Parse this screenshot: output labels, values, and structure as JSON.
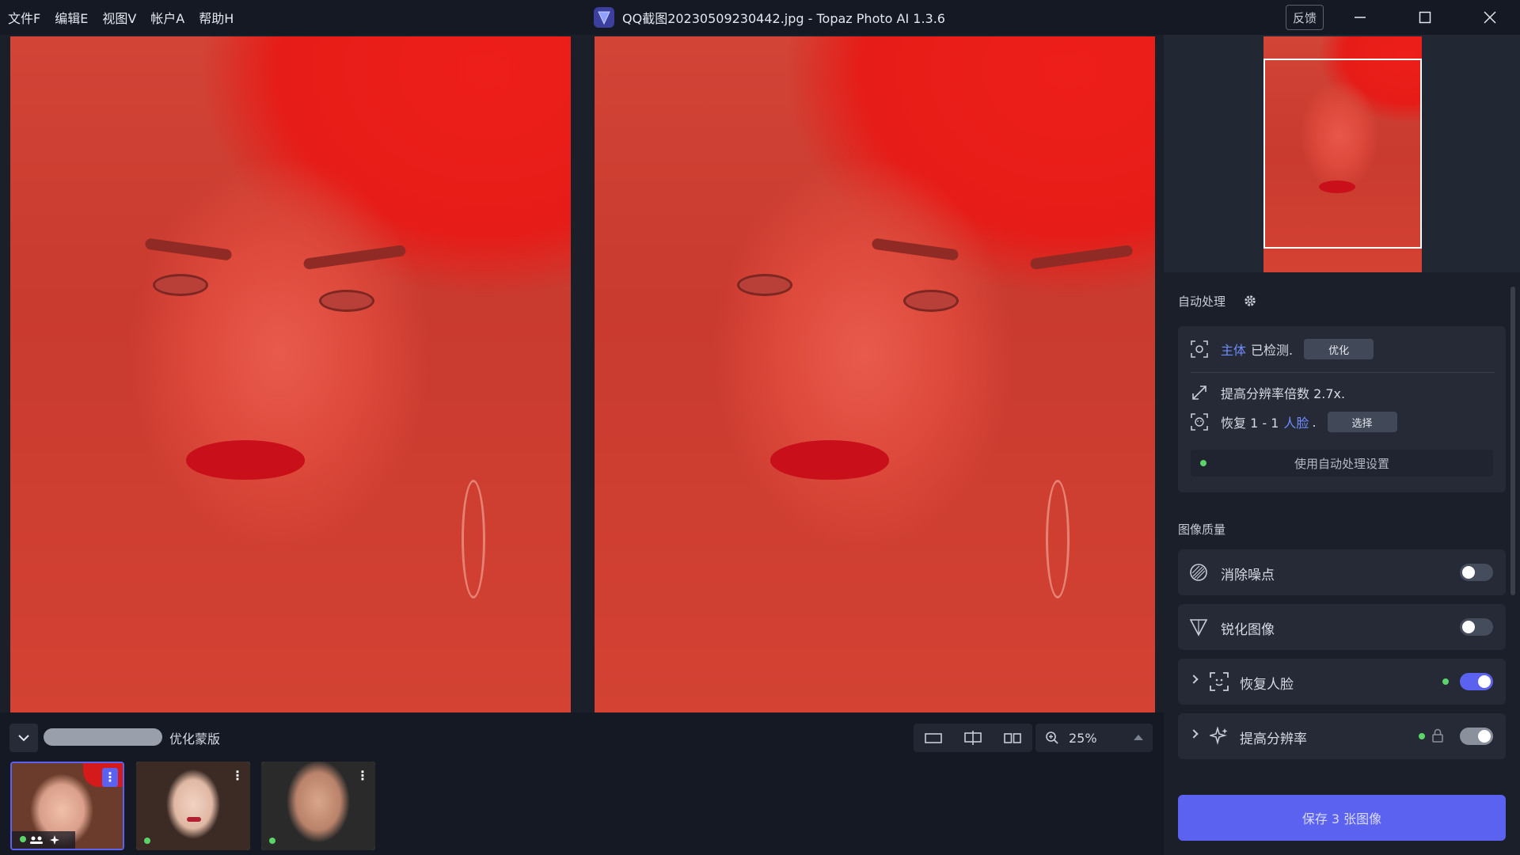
{
  "menu": [
    "文件F",
    "编辑E",
    "视图V",
    "帐户A",
    "帮助H"
  ],
  "window": {
    "title": "QQ截图20230509230442.jpg - Topaz Photo AI 1.3.6",
    "feedback": "反馈"
  },
  "bottom_bar": {
    "mask_label": "优化蒙版",
    "zoom": "25%"
  },
  "filmstrip": {
    "thumbs": [
      {
        "selected": true
      },
      {
        "selected": false
      },
      {
        "selected": false
      }
    ]
  },
  "auto": {
    "section": "自动处理",
    "subject_link": "主体",
    "subject_text": "已检测.",
    "optimize_btn": "优化",
    "upscale_text": "提高分辨率倍数 2.7x.",
    "face_text1": "恢复 1 - 1",
    "face_link": "人脸",
    "face_dot": ".",
    "select_btn": "选择",
    "use_auto_btn": "使用自动处理设置"
  },
  "quality": {
    "section": "图像质量",
    "denoise": "消除噪点",
    "sharpen": "锐化图像",
    "face_recovery": "恢复人脸",
    "upscale": "提高分辨率"
  },
  "save_button": "保存 3 张图像",
  "colors": {
    "accent": "#5b62f0",
    "active_dot": "#5bd46a",
    "link": "#6f8cff"
  }
}
